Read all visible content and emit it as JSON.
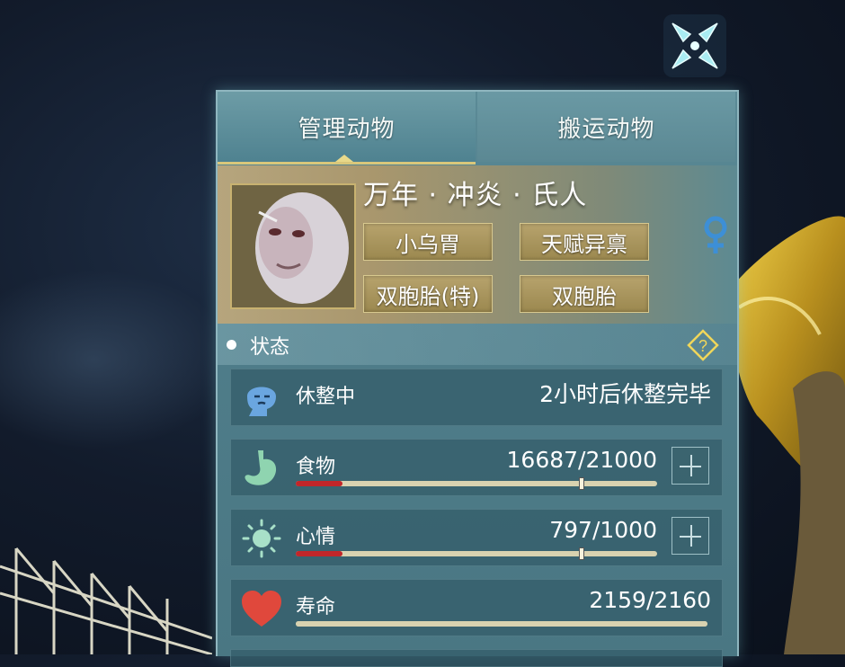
{
  "tabs": [
    {
      "label": "管理动物",
      "active": true
    },
    {
      "label": "搬运动物",
      "active": false
    }
  ],
  "animal": {
    "name": "万年 · 冲炎 · 氏人",
    "gender_icon": "female-icon",
    "traits": [
      "小乌胃",
      "天赋异禀",
      "双胞胎(特)",
      "双胞胎"
    ]
  },
  "status_section": {
    "title": "状态",
    "help_icon": "question-diamond-icon"
  },
  "rest": {
    "icon": "resting-face-icon",
    "label": "休整中",
    "value": "2小时后休整完毕"
  },
  "food": {
    "icon": "stomach-icon",
    "label": "食物",
    "value": "16687/21000",
    "fill": 0.13,
    "marker": 0.79
  },
  "mood": {
    "icon": "sun-icon",
    "label": "心情",
    "value": "797/1000",
    "fill": 0.13,
    "marker": 0.79
  },
  "life": {
    "icon": "heart-icon",
    "label": "寿命",
    "value": "2159/2160",
    "fill": 0.9995
  },
  "colors": {
    "panel": "#4f7d8a",
    "accent_gold": "#d9c77a",
    "bar_red": "#c2262a",
    "heart": "#e0483c",
    "gender": "#3d8fd6"
  }
}
